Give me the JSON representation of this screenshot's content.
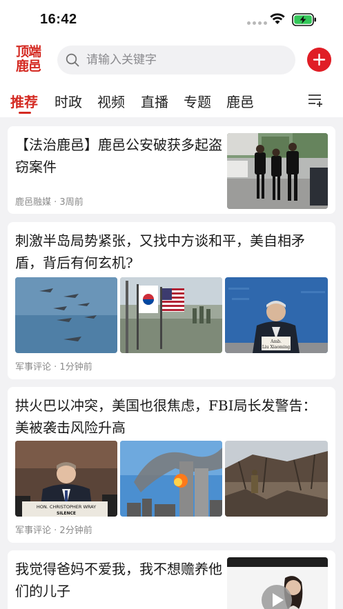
{
  "status": {
    "time": "16:42"
  },
  "header": {
    "logo_line1": "顶端",
    "logo_line2": "鹿邑",
    "search_placeholder": "请输入关键字"
  },
  "tabs": [
    "推荐",
    "时政",
    "视频",
    "直播",
    "专题",
    "鹿邑"
  ],
  "articles": [
    {
      "title": "【法治鹿邑】鹿邑公安破获多起盗窃案件",
      "source": "鹿邑融媒",
      "time": "3周前"
    },
    {
      "title": "刺激半岛局势紧张，又找中方谈和平，美自相矛盾，背后有何玄机?",
      "source": "军事评论",
      "time": "1分钟前",
      "image_caption_1": "Amb.",
      "image_caption_2": "Liu Xiaoming"
    },
    {
      "title": "拱火巴以冲突，美国也很焦虑，FBI局长发警告：美被袭击风险升高",
      "source": "军事评论",
      "time": "2分钟前",
      "image_caption_1": "HON. CHRISTOPHER WRAY",
      "image_caption_2": "SILENCE"
    },
    {
      "title": "我觉得爸妈不爱我，我不想赡养他们的儿子"
    }
  ]
}
